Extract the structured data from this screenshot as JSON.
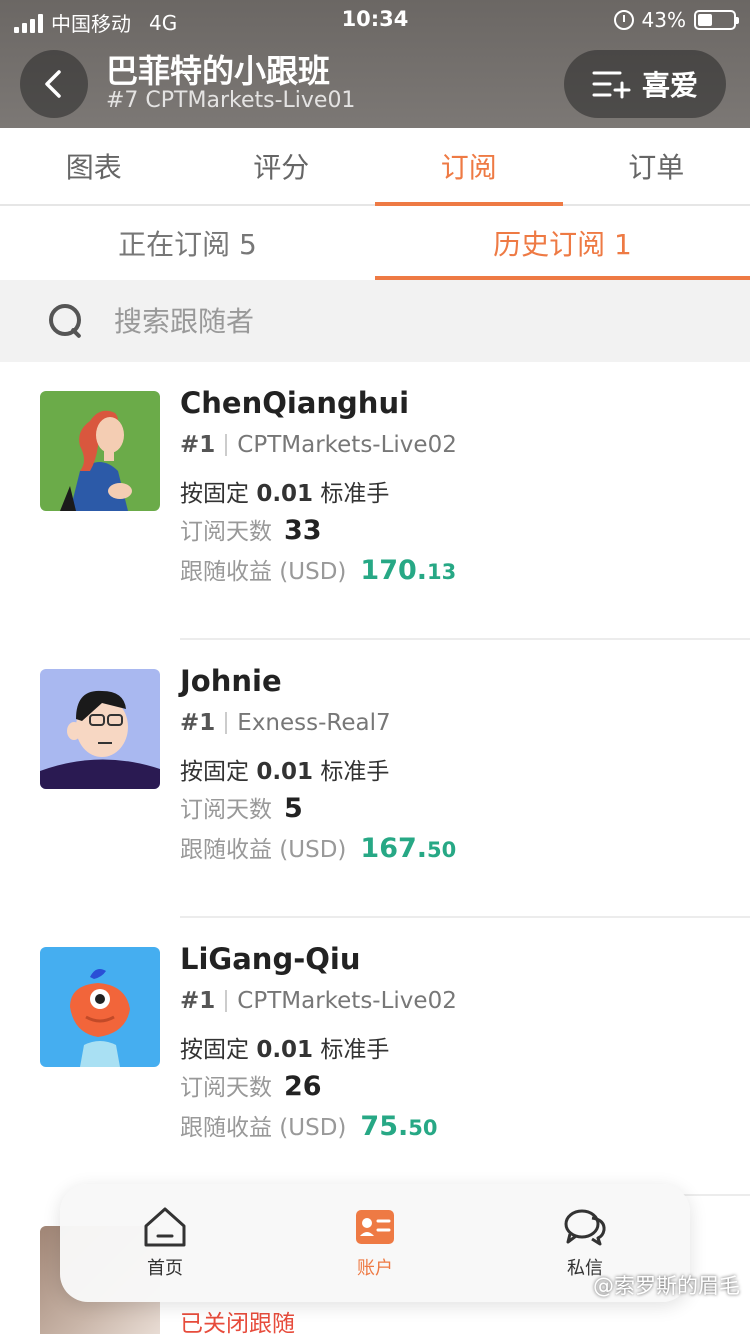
{
  "status_bar": {
    "carrier": "中国移动",
    "network": "4G",
    "time": "10:34",
    "battery": "43%"
  },
  "header": {
    "title": "巴菲特的小跟班",
    "subtitle": "#7 CPTMarkets-Live01",
    "favorite_label": "喜爱"
  },
  "tabs": [
    {
      "label": "图表"
    },
    {
      "label": "评分"
    },
    {
      "label": "订阅"
    },
    {
      "label": "订单"
    }
  ],
  "active_tab": "订阅",
  "subtabs": [
    {
      "label": "正在订阅 5"
    },
    {
      "label": "历史订阅 1"
    }
  ],
  "active_subtab": "历史订阅 1",
  "search": {
    "placeholder": "搜索跟随者"
  },
  "labels": {
    "mode_prefix": "按固定",
    "mode_suffix": "标准手",
    "days": "订阅天数",
    "profit": "跟随收益 (USD)"
  },
  "followers": [
    {
      "name": "ChenQianghui",
      "rank": "#1",
      "account": "CPTMarkets-Live02",
      "lot": "0.01",
      "days": "33",
      "profit_int": "170.",
      "profit_dec": "13",
      "avatar_icon": "avatar-woman-green"
    },
    {
      "name": "Johnie",
      "rank": "#1",
      "account": "Exness-Real7",
      "lot": "0.01",
      "days": "5",
      "profit_int": "167.",
      "profit_dec": "50",
      "avatar_icon": "avatar-man-glasses"
    },
    {
      "name": "LiGang-Qiu",
      "rank": "#1",
      "account": "CPTMarkets-Live02",
      "lot": "0.01",
      "days": "26",
      "profit_int": "75.",
      "profit_dec": "50",
      "avatar_icon": "avatar-cyclops-blue"
    }
  ],
  "partial_item": {
    "status": "已关闭跟随"
  },
  "bottom_nav": [
    {
      "label": "首页",
      "icon": "home-icon"
    },
    {
      "label": "账户",
      "icon": "account-card-icon"
    },
    {
      "label": "私信",
      "icon": "chat-bubbles-icon"
    }
  ],
  "active_nav": "账户",
  "watermark": "@索罗斯的眉毛",
  "colors": {
    "accent": "#ee7a44",
    "profit": "#27a885",
    "closed": "#e74c3c"
  }
}
